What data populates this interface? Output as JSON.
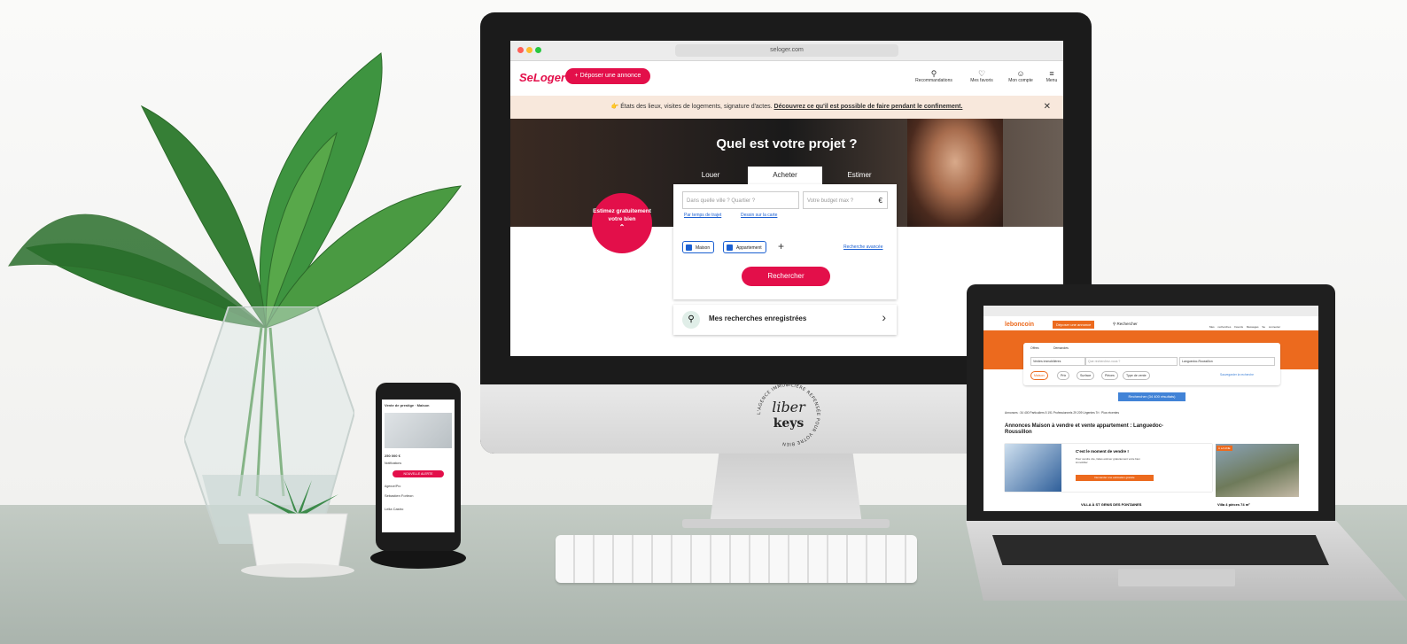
{
  "imac": {
    "url": "seloger.com",
    "logo": "SeLoger",
    "deposer": "+ Déposer une annonce",
    "nav": [
      {
        "label": "Recommandations",
        "icon": "bulb-icon",
        "glyph": "⚲"
      },
      {
        "label": "Mes favoris",
        "icon": "heart-icon",
        "glyph": "♡"
      },
      {
        "label": "Mon compte",
        "icon": "account-icon",
        "glyph": "☺"
      },
      {
        "label": "Menu",
        "icon": "menu-icon",
        "glyph": "≡"
      }
    ],
    "banner_text": "👉 États des lieux, visites de logements, signature d'actes.",
    "banner_link": "Découvrez ce qu'il est possible de faire pendant le confinement.",
    "close": "✕",
    "hero_title": "Quel est votre projet ?",
    "tabs": [
      "Louer",
      "Acheter",
      "Estimer"
    ],
    "estimate_bubble": "Estimez gratuitement votre bien",
    "city_placeholder": "Dans quelle ville ? Quartier ?",
    "budget_placeholder": "Votre budget max ?",
    "currency": "€",
    "link_time": "Par temps de trajet",
    "link_map": "Dessin sur la carte",
    "check_house": "Maison",
    "check_apartment": "Appartement",
    "plus": "+",
    "advanced": "Recherche avancée",
    "search_button": "Rechercher",
    "saved_searches": "Mes recherches enregistrées",
    "chevron": "›"
  },
  "seal": {
    "ring_text": "L'AGENCE IMMOBILIÈRE REPENSÉE POUR VOTRE BIEN",
    "brand_top": "liber",
    "brand_bottom": "keys"
  },
  "laptop": {
    "logo": "leboncoin",
    "deposer": "Déposer une annonce",
    "search": "Rechercher",
    "nav": [
      "Mes recherches",
      "Favoris",
      "Messages",
      "Se connecter"
    ],
    "offer": "Offres",
    "demand": "Demandes",
    "category": "Ventes immobilières",
    "what_placeholder": "Que recherchez-vous ?",
    "region": "Languedoc-Roussillon",
    "filters": [
      "Maison",
      "Prix",
      "Surface",
      "Pièces",
      "Type de vente"
    ],
    "save_search": "Sauvegarder la recherche",
    "results_button": "Rechercher (34 400 résultats)",
    "annonces_line": "Annonces : 34 400   Particuliers 5 191   Professionnels 29 209   Urgentes   Tri : Plus récentes",
    "heading": "Annonces Maison à vendre et vente appartement : Languedoc-Roussillon",
    "promo_title": "C'est le moment de vendre !",
    "promo_text": "Pour vendre vite, faites estimer gratuitement votre bien immobilier",
    "promo_button": "Demander une estimation gratuite",
    "badge_une": "À LA UNE",
    "listing_1": "VILLA À ST GENIS DES FONTAINES",
    "listing_2": "Villa 4 pièces 74 m²"
  },
  "phone": {
    "title": "Vente de prestige · Maison",
    "price": "250 000 €",
    "notif": "Notifications",
    "button": "NOUVELLE ALERTE",
    "section": "Agence/Pro",
    "agent": "Sebastien Forleon",
    "footer": "Lelia Castro"
  }
}
